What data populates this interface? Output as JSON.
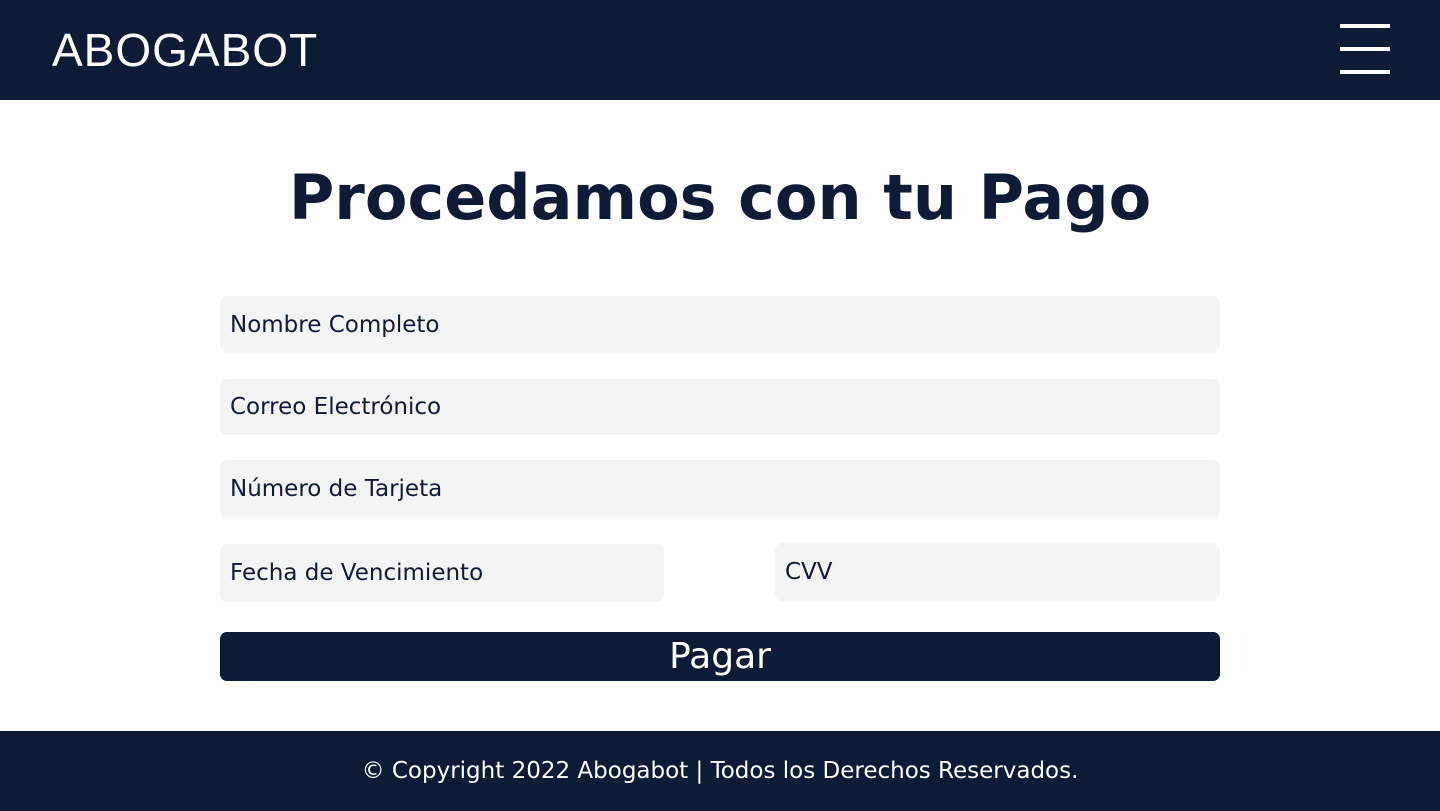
{
  "header": {
    "logo": "ABOGABOT",
    "menu_icon": "hamburger-menu-icon"
  },
  "main": {
    "title": "Procedamos con tu Pago",
    "form": {
      "full_name": {
        "placeholder": "Nombre Completo",
        "value": ""
      },
      "email": {
        "placeholder": "Correo Electrónico",
        "value": ""
      },
      "card_number": {
        "placeholder": "Número de Tarjeta",
        "value": ""
      },
      "expiry_date": {
        "placeholder": "Fecha de Vencimiento",
        "value": ""
      },
      "cvv": {
        "placeholder": "CVV",
        "value": ""
      },
      "submit_label": "Pagar"
    }
  },
  "footer": {
    "copyright": "© Copyright 2022 Abogabot | Todos los Derechos Reservados."
  },
  "colors": {
    "brand_navy": "#0e1b36",
    "field_bg": "#f4f4f4",
    "text_on_dark": "#ffffff"
  }
}
